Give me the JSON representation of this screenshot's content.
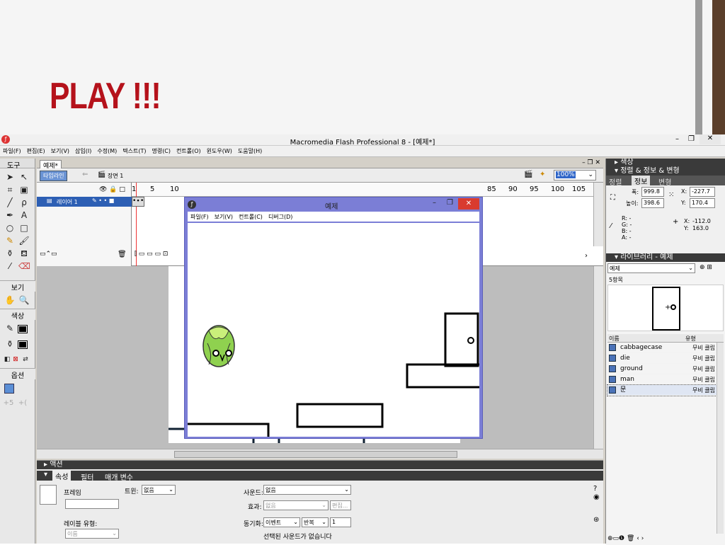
{
  "slide": {
    "title": "PLAY !!!"
  },
  "app": {
    "title": "Macromedia Flash Professional 8 - [예제*]",
    "menu": [
      "파일(F)",
      "편집(E)",
      "보기(V)",
      "삽입(I)",
      "수정(M)",
      "텍스트(T)",
      "명령(C)",
      "컨트롤(O)",
      "윈도우(W)",
      "도움말(H)"
    ],
    "window_controls": {
      "minimize": "–",
      "restore": "❐",
      "close": "✕"
    }
  },
  "tools": {
    "header": "도구",
    "view_label": "보기",
    "color_label": "색상",
    "options_label": "옵션"
  },
  "document": {
    "tab": "예제*",
    "timeline_button": "타임라인",
    "scene": "장면 1",
    "zoom": "100%",
    "layer_name": "레이어 1",
    "frame_numbers": [
      "1",
      "5",
      "10",
      "85",
      "90",
      "95",
      "100",
      "105"
    ]
  },
  "player": {
    "title": "예제",
    "menu": [
      "파일(F)",
      "보기(V)",
      "컨트롤(C)",
      "디버그(D)"
    ]
  },
  "panels": {
    "color": "색상",
    "align_info": "정렬 & 정보 & 변형",
    "tabs": [
      "정렬",
      "정보",
      "변형"
    ],
    "info": {
      "width_label": "폭:",
      "width": "999.8",
      "height_label": "높이:",
      "height": "398.6",
      "x_label": "X:",
      "x": "-227.7",
      "y_label": "Y:",
      "y": "170.4",
      "r": "R: -",
      "g": "G: -",
      "b": "B: -",
      "a": "A: -",
      "cursor_x_label": "X:",
      "cursor_x": "-112.0",
      "cursor_y_label": "Y:",
      "cursor_y": "163.0"
    },
    "library": {
      "title": "라이브러리 - 예제",
      "doc": "예제",
      "count": "5항목",
      "col_name": "이름",
      "col_type": "유형",
      "items": [
        {
          "name": "cabbagecase",
          "type": "무비 클립"
        },
        {
          "name": "die",
          "type": "무비 클립"
        },
        {
          "name": "ground",
          "type": "무비 클립"
        },
        {
          "name": "man",
          "type": "무비 클립"
        },
        {
          "name": "문",
          "type": "무비 클립"
        }
      ]
    }
  },
  "properties": {
    "actions": "액션",
    "tabs": [
      "속성",
      "필터",
      "매개 변수"
    ],
    "frame_label": "프레임",
    "tween_label": "트윈:",
    "tween_value": "없음",
    "sound_label": "사운드:",
    "sound_value": "없음",
    "effect_label": "효과:",
    "effect_value": "없음",
    "edit_button": "편집...",
    "sync_label": "동기화:",
    "sync_value": "이벤트",
    "repeat_value": "반복",
    "repeat_count": "1",
    "label_type_label": "레이블 유형:",
    "label_type_value": "이름",
    "status": "선택된 사운드가 없습니다"
  }
}
